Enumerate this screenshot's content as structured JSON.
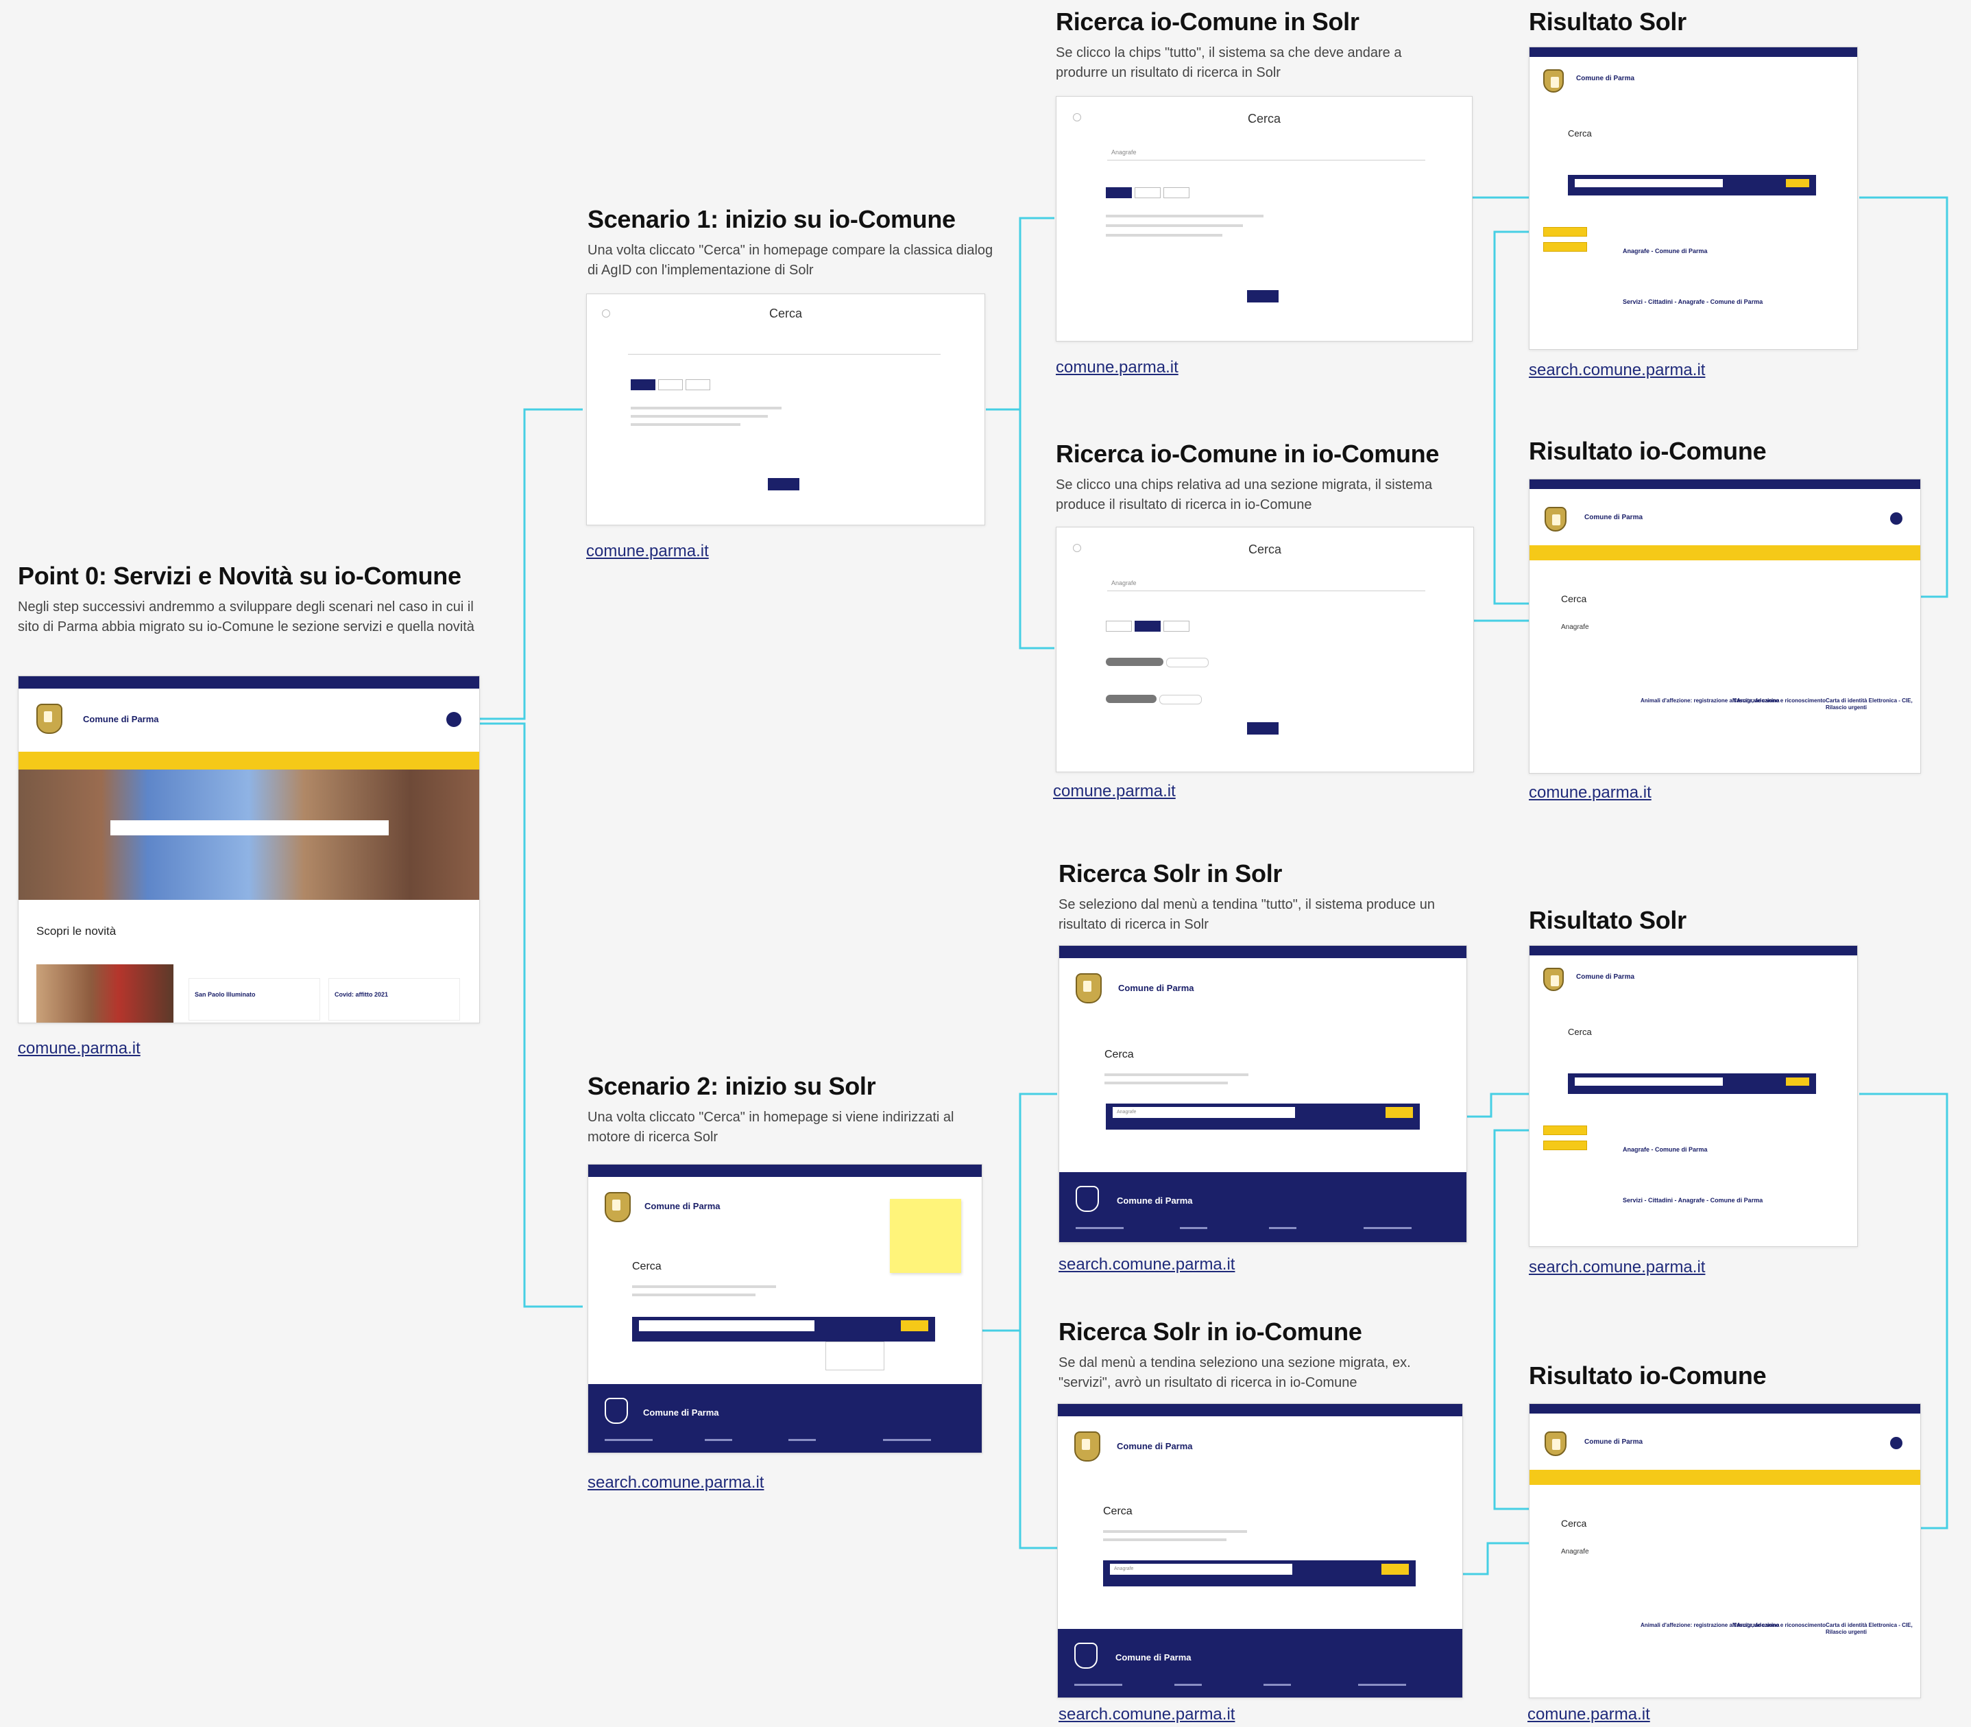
{
  "site": {
    "name": "Comune di Parma",
    "dialog_title": "Cerca",
    "page_title": "Cerca",
    "search_query": "Anagrafe",
    "novita_heading": "Scopri le novità",
    "news_1_title": "San Paolo Illuminato",
    "news_2_title": "Covid: affitto 2021"
  },
  "sections": [
    {
      "title": "Point 0: Servizi e Novità su io-Comune",
      "description": "Negli step successivi andremmo a sviluppare degli scenari nel caso in cui il sito di Parma abbia migrato su io-Comune le sezione servizi e quella novità",
      "link": "comune.parma.it"
    },
    {
      "title": "Scenario 1: inizio su io-Comune",
      "description": "Una volta cliccato \"Cerca\" in homepage compare la classica dialog di AgID con l'implementazione di Solr",
      "link": "comune.parma.it"
    },
    {
      "title": "Scenario 2: inizio su Solr",
      "description": "Una volta cliccato \"Cerca\" in homepage si viene indirizzati al motore di ricerca Solr",
      "link": "search.comune.parma.it"
    },
    {
      "title": "Ricerca io-Comune in Solr",
      "description": "Se clicco la chips \"tutto\", il sistema sa che deve andare a produrre un risultato di ricerca in Solr",
      "link": "comune.parma.it"
    },
    {
      "title": "Ricerca io-Comune in io-Comune",
      "description": "Se clicco una chips relativa ad una sezione migrata, il sistema produce il risultato di ricerca in io-Comune",
      "link": "comune.parma.it"
    },
    {
      "title": "Ricerca Solr in Solr",
      "description": "Se seleziono dal menù a tendina \"tutto\", il sistema produce un risultato di ricerca in Solr",
      "link": "search.comune.parma.it"
    },
    {
      "title": "Ricerca Solr in io-Comune",
      "description": "Se dal menù a tendina seleziono una sezione migrata, ex. \"servizi\", avrò un risultato di ricerca in io-Comune",
      "link": "search.comune.parma.it"
    },
    {
      "title": "Risultato Solr",
      "link": "search.comune.parma.it"
    },
    {
      "title": "Risultato io-Comune",
      "link": "comune.parma.it"
    },
    {
      "title": "Risultato Solr",
      "link": "search.comune.parma.it"
    },
    {
      "title": "Risultato io-Comune",
      "link": "comune.parma.it"
    }
  ],
  "colors": {
    "navy": "#1b2069",
    "yellow": "#f5c918",
    "connector": "#3fd0e6",
    "link": "#1f2a7a"
  }
}
